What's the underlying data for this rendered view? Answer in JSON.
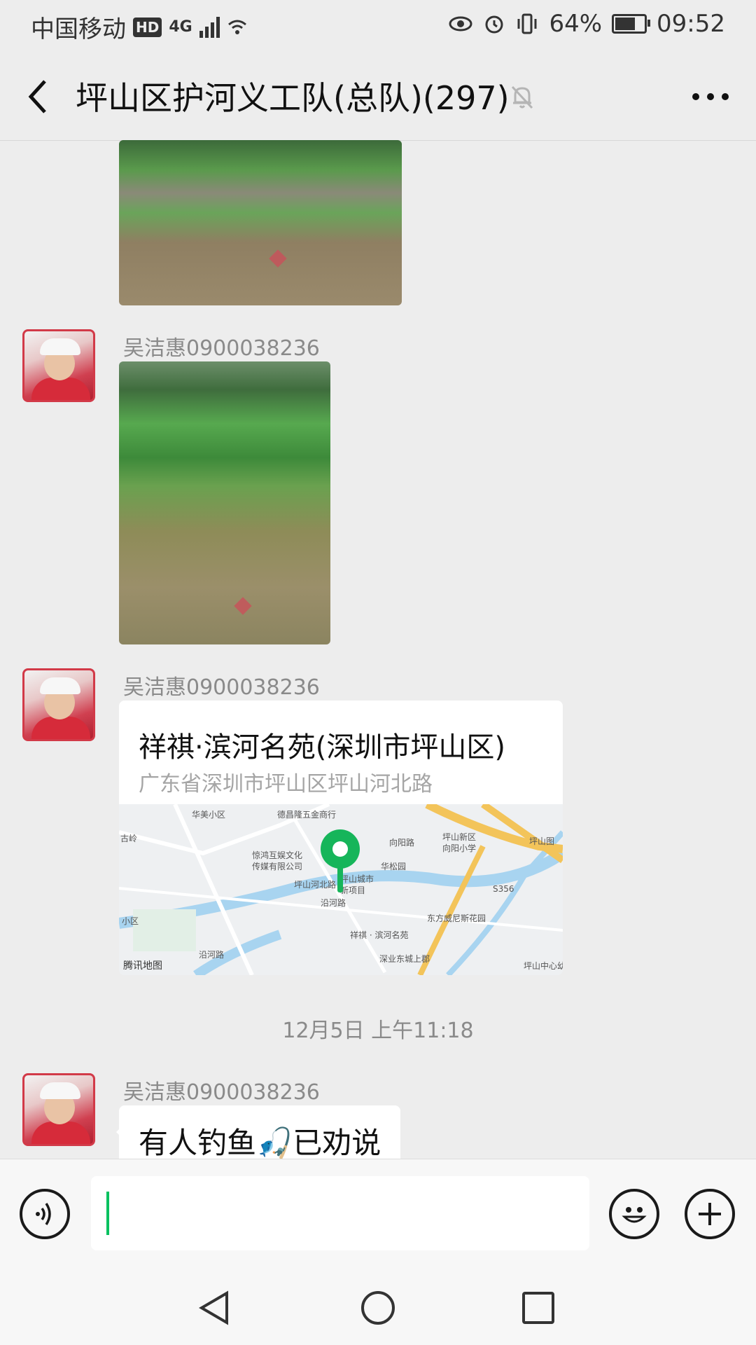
{
  "status_bar": {
    "carrier": "中国移动",
    "hd_badge": "HD",
    "network": "4G",
    "battery": "64%",
    "battery_level": 0.64,
    "time": "09:52",
    "icons": [
      "eye-icon",
      "alarm-icon",
      "vibrate-icon",
      "battery-icon",
      "wifi-icon",
      "signal-icon"
    ]
  },
  "header": {
    "title": "坪山区护河义工队(总队)(297)",
    "back_icon": "chevron-left-icon",
    "mute_icon": "bell-off-icon",
    "more_icon": "more-dots-icon"
  },
  "messages": {
    "m1": {
      "sender": "吴洁惠0900038236"
    },
    "m2": {
      "sender": "吴洁惠0900038236",
      "location_name": "祥祺·滨河名苑(深圳市坪山区)",
      "location_address": "广东省深圳市坪山区坪山河北路",
      "map_credit": "腾讯地图",
      "map_labels": [
        "华美小区",
        "德昌隆五金商行",
        "坪山新区",
        "向阳小学",
        "坪山图",
        "惊鸿互娱文化",
        "传媒有限公司",
        "华松园",
        "向阳路",
        "坪山河北路",
        "坪山城市",
        "新项目",
        "沿河路",
        "S356",
        "东方威尼斯花园",
        "祥祺 · 滨河名苑",
        "深业东城上郡",
        "坪山中心幼",
        "沿河路",
        "古岭",
        "小区"
      ]
    },
    "timestamp": "12月5日 上午11:18",
    "m3": {
      "sender": "吴洁惠0900038236",
      "text": "有人钓鱼🎣已劝说"
    }
  },
  "input_bar": {
    "voice_icon": "voice-icon",
    "emoji_icon": "emoji-icon",
    "plus_icon": "plus-icon",
    "text": ""
  },
  "nav_bar": {
    "icons": [
      "nav-back-icon",
      "nav-home-icon",
      "nav-recents-icon"
    ]
  },
  "colors": {
    "accent": "#07c160",
    "background": "#ededed",
    "avatar_border": "#d23a48"
  }
}
